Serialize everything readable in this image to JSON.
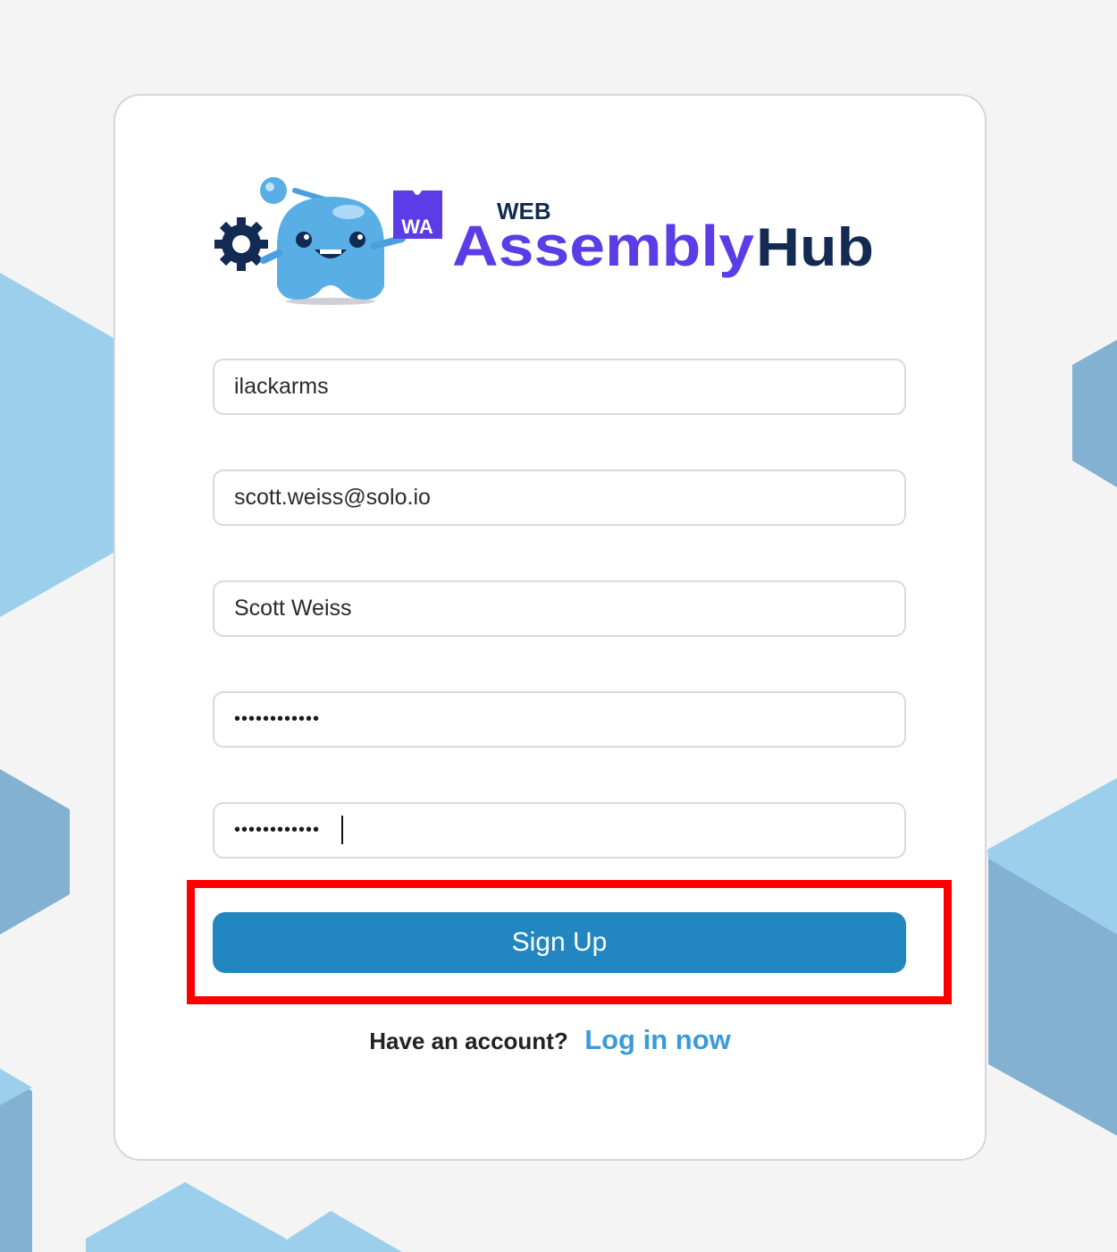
{
  "brand": {
    "logo_badge": "WA",
    "logo_word_small": "WEB",
    "logo_word_main": "Assembly",
    "logo_word_accent": "Hub",
    "colors": {
      "purple": "#5a3de6",
      "navy": "#132a52",
      "mascot": "#5aaee6"
    }
  },
  "form": {
    "username": {
      "value": "ilackarms"
    },
    "email": {
      "value": "scott.weiss@solo.io"
    },
    "full_name": {
      "value": "Scott Weiss"
    },
    "password": {
      "value": "••••••••••••"
    },
    "confirm_password": {
      "value": "••••••••••••"
    },
    "submit_label": "Sign Up"
  },
  "footer": {
    "prompt": "Have an account?",
    "login_link": "Log in now"
  },
  "colors": {
    "primary": "#2287c1",
    "link": "#3a9bd9",
    "highlight": "#ff0000",
    "background": "#f4f4f5"
  }
}
